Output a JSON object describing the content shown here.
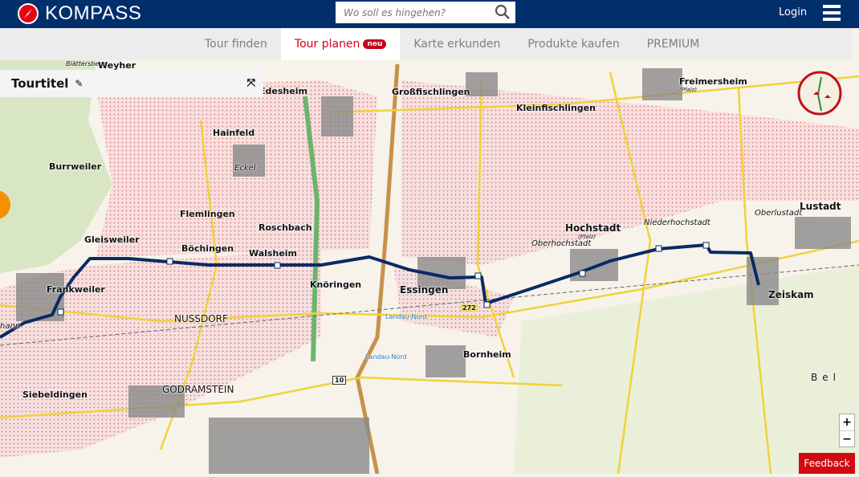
{
  "header": {
    "brand": "KOMPASS",
    "search_placeholder": "Wo soll es hingehen?",
    "login": "Login"
  },
  "nav": {
    "tabs": [
      {
        "label": "Tour finden"
      },
      {
        "label": "Tour planen",
        "badge": "neu"
      },
      {
        "label": "Karte erkunden"
      },
      {
        "label": "Produkte kaufen"
      },
      {
        "label": "PREMIUM"
      }
    ]
  },
  "panel": {
    "title": "Tourtitel"
  },
  "map": {
    "places": [
      "Weyher",
      "Edesheim",
      "Großfischlingen",
      "Kleinfischlingen",
      "Freimersheim",
      "(Pfalz)",
      "Hainfeld",
      "Eckel",
      "Burrweiler",
      "Flemlingen",
      "Roschbach",
      "Gleisweiler",
      "Böchingen",
      "Walsheim",
      "Knöringen",
      "Frankweiler",
      "Essingen",
      "Hochstadt",
      "(Pfalz)",
      "Oberhochstadt",
      "Niederhochstadt",
      "Oberlustadt",
      "Lustadt",
      "Zeiskam",
      "NUSSDORF",
      "Bornheim",
      "GODRAMSTEIN",
      "Siebeldingen",
      "Landau-Nord",
      "Landau-Nord",
      "272",
      "10",
      "Bel",
      "hann",
      "Blättersberg"
    ]
  },
  "controls": {
    "zoom_in": "+",
    "zoom_out": "−",
    "feedback": "Feedback"
  },
  "colors": {
    "header": "#002f6c",
    "accent": "#d4001a",
    "route": "#0a2a66"
  }
}
